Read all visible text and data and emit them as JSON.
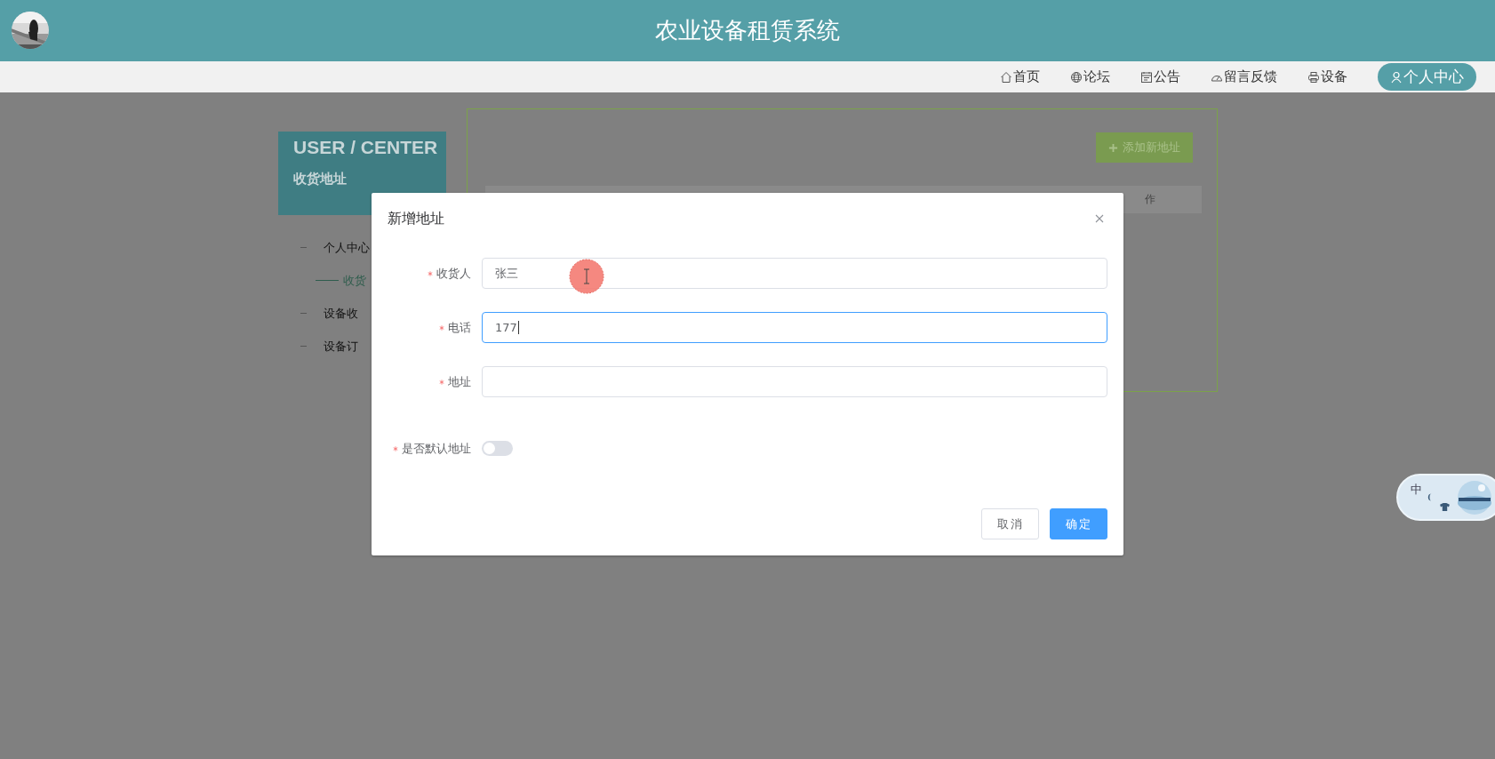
{
  "header": {
    "title": "农业设备租赁系统"
  },
  "nav": [
    {
      "label": "首页",
      "selected": false
    },
    {
      "label": "论坛",
      "selected": false
    },
    {
      "label": "公告",
      "selected": false
    },
    {
      "label": "留言反馈",
      "selected": false
    },
    {
      "label": "设备",
      "selected": false
    },
    {
      "label": "个人中心",
      "selected": true
    }
  ],
  "sidebar": {
    "title": "USER / CENTER",
    "subtitle": "收货地址",
    "items": [
      {
        "label": "个人中心",
        "selected": false
      },
      {
        "label": "收货",
        "selected": true
      },
      {
        "label": "设备收",
        "selected": false
      },
      {
        "label": "设备订",
        "selected": false
      }
    ]
  },
  "content": {
    "add_button": "添加新地址",
    "table_header": "作"
  },
  "dialog": {
    "title": "新增地址",
    "fields": [
      {
        "kind": "text",
        "label": "收货人",
        "required": true,
        "value": "张三",
        "focused": false
      },
      {
        "kind": "text",
        "label": "电话",
        "required": true,
        "value": "177",
        "focused": true
      },
      {
        "kind": "text",
        "label": "地址",
        "required": true,
        "focused": false
      },
      {
        "kind": "switch",
        "label": "是否默认地址",
        "required": true,
        "on": false
      }
    ],
    "buttons": [
      {
        "label": "取消",
        "kind": "default"
      },
      {
        "label": "确定",
        "kind": "primary"
      }
    ]
  },
  "ime": {
    "label": "中"
  }
}
